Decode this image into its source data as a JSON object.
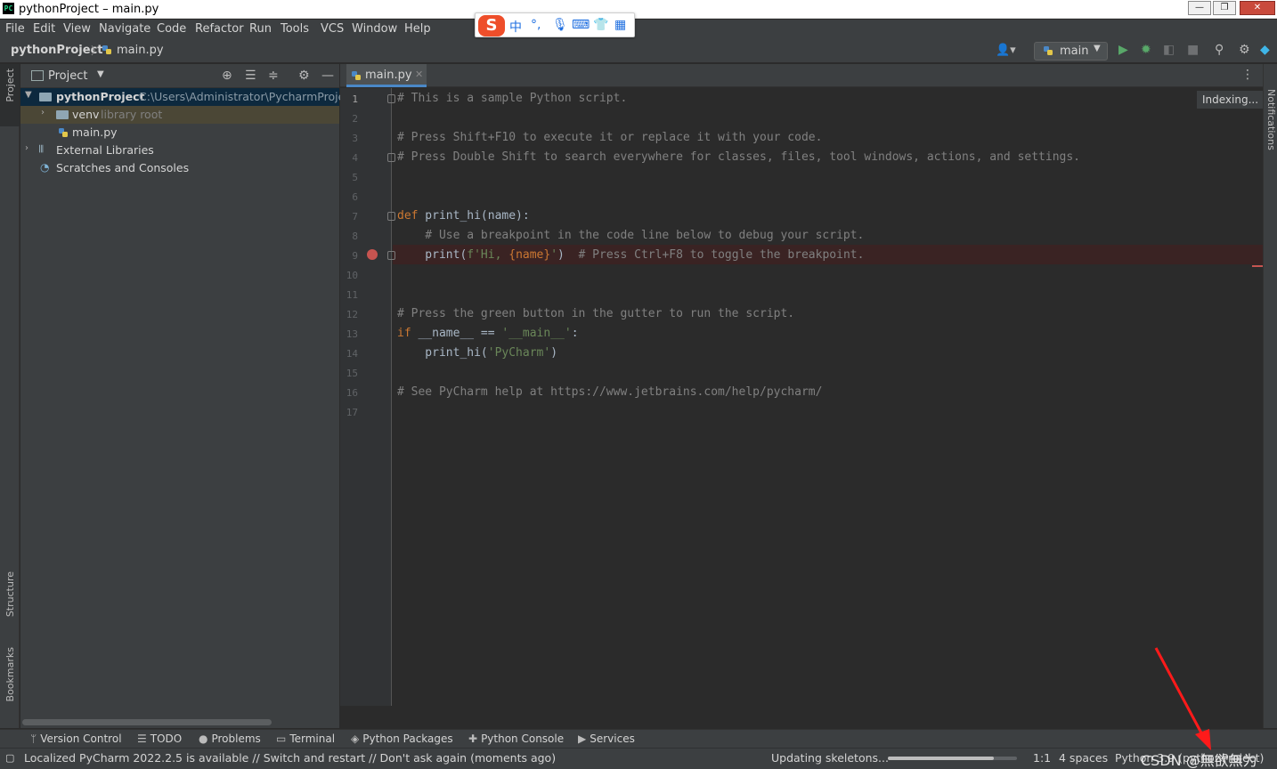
{
  "window": {
    "title": "pythonProject – main.py"
  },
  "ime": {
    "zh": "中",
    "punct": "°,"
  },
  "menu": [
    "File",
    "Edit",
    "View",
    "Navigate",
    "Code",
    "Refactor",
    "Run",
    "Tools",
    "VCS",
    "Window",
    "Help"
  ],
  "breadcrumb": {
    "project": "pythonProject",
    "file": "main.py"
  },
  "run_config": {
    "label": "main"
  },
  "left_strip": {
    "project": "Project",
    "structure": "Structure",
    "bookmarks": "Bookmarks"
  },
  "right_strip": {
    "notifications": "Notifications"
  },
  "project_panel": {
    "title": "Project",
    "tree": [
      {
        "label": "pythonProject",
        "hint": "C:\\Users\\Administrator\\PycharmProject"
      },
      {
        "label": "venv",
        "hint": "library root"
      },
      {
        "label": "main.py"
      },
      {
        "label": "External Libraries"
      },
      {
        "label": "Scratches and Consoles"
      }
    ]
  },
  "editor": {
    "tab_label": "main.py",
    "indexing": "Indexing...",
    "line_numbers": [
      "1",
      "2",
      "3",
      "4",
      "5",
      "6",
      "7",
      "8",
      "9",
      "10",
      "11",
      "12",
      "13",
      "14",
      "15",
      "16",
      "17"
    ],
    "code": {
      "l1": "# This is a sample Python script.",
      "l3": "# Press Shift+F10 to execute it or replace it with your code.",
      "l4": "# Press Double Shift to search everywhere for classes, files, tool windows, actions, and settings.",
      "l7_kw": "def",
      "l7_rest": " print_hi(name):",
      "l8": "    # Use a breakpoint in the code line below to debug your script.",
      "l9_a": "    print(",
      "l9_str1": "f'Hi, ",
      "l9_b": "{name}",
      "l9_str2": "'",
      "l9_c": ")  ",
      "l9_cmt": "# Press Ctrl+F8 to toggle the breakpoint.",
      "l12": "# Press the green button in the gutter to run the script.",
      "l13_kw": "if",
      "l13_a": " __name__ == ",
      "l13_str": "'__main__'",
      "l13_b": ":",
      "l14_a": "    print_hi(",
      "l14_str": "'PyCharm'",
      "l14_b": ")",
      "l16": "# See PyCharm help at https://www.jetbrains.com/help/pycharm/"
    }
  },
  "bottom_tools": [
    "Version Control",
    "TODO",
    "Problems",
    "Terminal",
    "Python Packages",
    "Python Console",
    "Services"
  ],
  "status": {
    "message": "Localized PyCharm 2022.2.5 is available // Switch and restart // Don't ask again (moments ago)",
    "task": "Updating skeletons...",
    "progress": 0.82,
    "position": "1:1",
    "indent": "4 spaces",
    "interpreter": "Python 3.9 (pythonProject)",
    "watermark": "CSDN @無欲無为"
  },
  "colors": {
    "breakpoint": "#c75450",
    "keyword": "#cc7832",
    "string": "#6a8759",
    "comment": "#808080",
    "run_green": "#59a869"
  }
}
